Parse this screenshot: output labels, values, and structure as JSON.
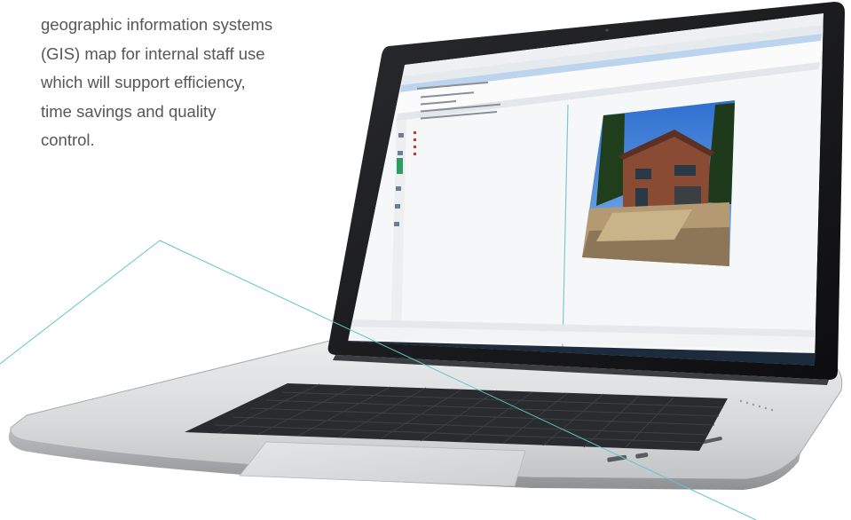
{
  "intro": {
    "lines": [
      "geographic information systems",
      "(GIS) map for internal staff use",
      "which will support efficiency,",
      "time savings and quality",
      "control."
    ]
  },
  "colors": {
    "text": "#56565b",
    "accent_line": "#5ec7c9",
    "laptop_body": "#d9dadc",
    "bezel": "#141416"
  },
  "icons": [
    "laptop-illustration",
    "house-photo"
  ]
}
